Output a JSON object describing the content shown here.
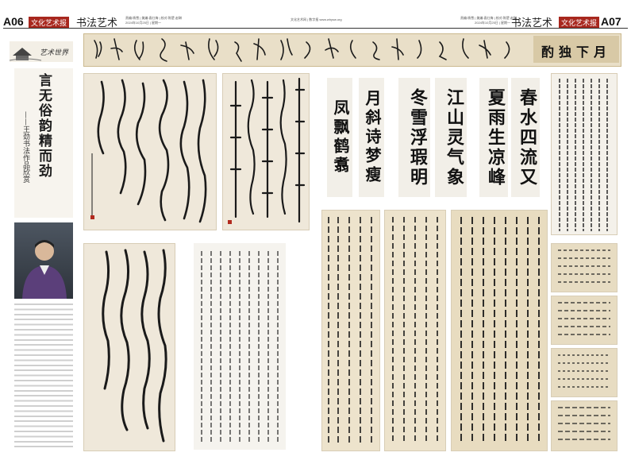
{
  "header_left": {
    "page_number": "A06",
    "brand": "文化艺术报",
    "section": "书法艺术",
    "editors": "责编:杨雪 | 美编:袁红梅 | 校对:陈楚 赵琳",
    "date": "2024年10月25日 | 星期一"
  },
  "header_center": {
    "site": "文化艺术网 | 数字报 www.whysw.org"
  },
  "header_right": {
    "editors": "责编:杨雪 | 美编:袁红梅 | 校对:陈楚 赵琳",
    "date": "2024年10月25日 | 星期一",
    "section": "书法艺术",
    "brand": "文化艺术报",
    "page_number": "A07"
  },
  "column_logo": "艺术世界",
  "feature": {
    "title": "言无俗韵精而劲",
    "subtitle": "——王劲书法作品欣赏"
  },
  "banner": {
    "label": "酌独下月"
  },
  "artworks": {
    "pair1_left": "凤飘鹤翥",
    "pair1_right": "月斜诗梦瘦",
    "pair2_left": "冬雪浮瑕明",
    "pair2_right": "江山灵气象",
    "pair3_left": "夏雨生凉峰",
    "pair3_right": "春水四流又"
  },
  "colors": {
    "brand_red": "#a8271e",
    "paper": "#efe8da",
    "ink": "#1a1a1a"
  }
}
